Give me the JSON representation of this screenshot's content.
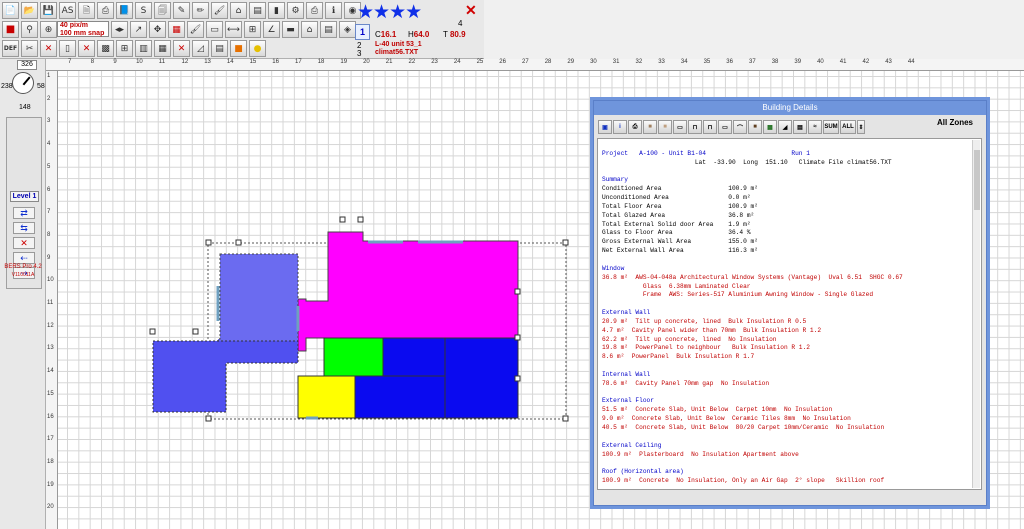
{
  "toolbar": {
    "snap_line1": "40 pix/m",
    "snap_line2": "100 mm snap",
    "stars": "★★★★",
    "star_count": "4",
    "level_1": "1",
    "level_2": "2",
    "level_2_sub": "3",
    "def_label": "DEF",
    "stat_c_label": "C",
    "stat_c": "16.1",
    "stat_h_label": "H",
    "stat_h": "64.0",
    "stat_t_label": "T",
    "stat_t": "80.9",
    "info_line1": "L-40 unit 53_1",
    "info_line2": "climat56.TXT",
    "icons": [
      "new-file-icon",
      "open-folder-icon",
      "save-icon",
      "as-icon",
      "export-icon",
      "print-icon",
      "book-icon",
      "s-icon",
      "page-icon",
      "edit-icon",
      "draw-icon",
      "paint-icon",
      "window-icon",
      "stack-icon",
      "chart-icon",
      "settings-icon",
      "print2-icon",
      "info-icon",
      "globe-icon"
    ]
  },
  "left_panel": {
    "compass_value": "326",
    "compass_left": "238",
    "compass_right": "58",
    "compass_bottom": "148",
    "level_label": "Level 1",
    "bers_name": "BERS Pro 4.2",
    "bers_version": "V110011A"
  },
  "ruler_top": [
    "7",
    "8",
    "9",
    "10",
    "11",
    "12",
    "13",
    "14",
    "15",
    "16",
    "17",
    "18",
    "19",
    "20",
    "21",
    "22",
    "23",
    "24",
    "25",
    "26",
    "27",
    "28",
    "29",
    "30",
    "31",
    "32",
    "33",
    "34",
    "35",
    "36",
    "37",
    "38",
    "39",
    "40",
    "41",
    "42",
    "43",
    "44"
  ],
  "ruler_left": [
    "1",
    "2",
    "3",
    "4",
    "5",
    "6",
    "7",
    "8",
    "9",
    "10",
    "11",
    "12",
    "13",
    "14",
    "15",
    "16",
    "17",
    "18",
    "19",
    "20"
  ],
  "dialog": {
    "title": "Building Details",
    "all_zones": "All Zones",
    "toolbar": [
      "save",
      "info",
      "print",
      "wall",
      "floor",
      "roof",
      "window",
      "door",
      "skylight",
      "shade",
      "zone",
      "chart",
      "fan",
      "plant",
      "sum",
      "all"
    ],
    "sum_label": "SUM",
    "all_label": "ALL"
  },
  "report": {
    "project_line": "Project   A-100 - Unit B1-04                       Run 1",
    "location_line": "                         Lat  -33.90  Long  151.10   Climate File climat56.TXT",
    "summary_title": "Summary",
    "summary": [
      [
        "Conditioned Area",
        "100.9 m²"
      ],
      [
        "Unconditioned Area",
        "0.0 m²"
      ],
      [
        "Total Floor Area",
        "100.9 m²"
      ],
      [
        "Total Glazed Area",
        "36.8 m²"
      ],
      [
        "Total External Solid door Area",
        "1.9 m²"
      ],
      [
        "Glass to Floor Area",
        "36.4 %"
      ],
      [
        "Gross External Wall Area",
        "155.0 m²"
      ],
      [
        "Net External Wall Area",
        "116.3 m²"
      ]
    ],
    "window_title": "Window",
    "window_lines": [
      "36.8 m²  AWS-04-048a Architectural Window Systems (Vantage)  Uval 6.51  SHGC 0.67",
      "           Glass  6.38mm Laminated Clear",
      "           Frame  AWS: Series-517 Aluminium Awning Window - Single Glazed"
    ],
    "ext_wall_title": "External Wall",
    "ext_wall_lines": [
      "20.9 m²  Tilt up concrete, lined  Bulk Insulation R 0.5",
      "4.7 m²  Cavity Panel wider than 70mm  Bulk Insulation R 1.2",
      "62.2 m²  Tilt up concrete, lined  No Insulation",
      "19.8 m²  PowerPanel to neighbour   Bulk Insulation R 1.2",
      "8.6 m²  PowerPanel  Bulk Insulation R 1.7"
    ],
    "int_wall_title": "Internal Wall",
    "int_wall_lines": [
      "78.6 m²  Cavity Panel 70mm gap  No Insulation"
    ],
    "ext_floor_title": "External Floor",
    "ext_floor_lines": [
      "51.5 m²  Concrete Slab, Unit Below  Carpet 10mm  No Insulation",
      "9.0 m²  Concrete Slab, Unit Below  Ceramic Tiles 8mm  No Insulation",
      "40.5 m²  Concrete Slab, Unit Below  80/20 Carpet 10mm/Ceramic  No Insulation"
    ],
    "ext_ceiling_title": "External Ceiling",
    "ext_ceiling_lines": [
      "100.9 m²  Plasterboard  No Insulation Apartment above"
    ],
    "roof_title": "Roof (Horizontal area)",
    "roof_lines": [
      "100.9 m²  Concrete  No Insulation, Only an Air Gap  2° slope   Skillion roof"
    ]
  },
  "colors": {
    "magenta_zone": "#ff00ff",
    "periwinkle_zone": "#6b6bf0",
    "blue_zone": "#5050f0",
    "dark_blue_zone": "#0a0af0",
    "green_zone": "#00ff00",
    "yellow_zone": "#ffff00",
    "dialog_title_bg": "#6f95dc",
    "report_heading": "#0000c8",
    "report_value": "#c00000"
  }
}
